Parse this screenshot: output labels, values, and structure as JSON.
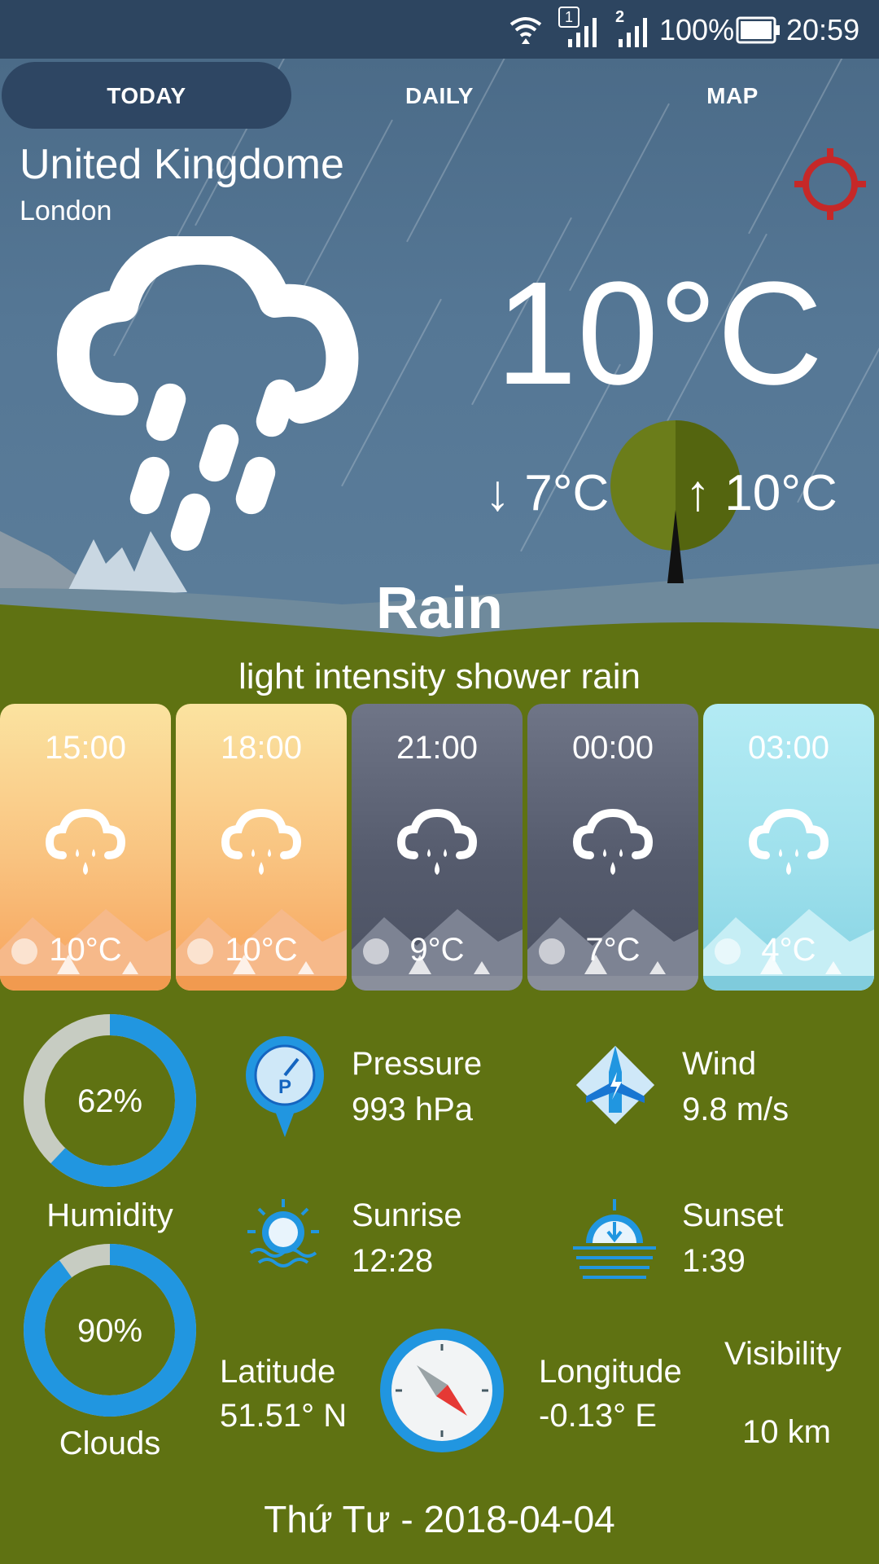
{
  "status_bar": {
    "sim1": "1",
    "sim2": "2",
    "battery": "100%",
    "time": "20:59"
  },
  "tabs": [
    {
      "label": "TODAY"
    },
    {
      "label": "DAILY"
    },
    {
      "label": "MAP"
    }
  ],
  "location": {
    "country": "United Kingdome",
    "city": "London"
  },
  "current": {
    "temp": "10°C",
    "min": "↓ 7°C",
    "max": "↑ 10°C",
    "condition": "Rain",
    "description": "light intensity shower rain"
  },
  "forecast": [
    {
      "time": "15:00",
      "temp": "10°C",
      "theme": "day"
    },
    {
      "time": "18:00",
      "temp": "10°C",
      "theme": "day"
    },
    {
      "time": "21:00",
      "temp": "9°C",
      "theme": "night"
    },
    {
      "time": "00:00",
      "temp": "7°C",
      "theme": "night"
    },
    {
      "time": "03:00",
      "temp": "4°C",
      "theme": "dawn"
    }
  ],
  "humidity": {
    "value": "62%",
    "label": "Humidity",
    "level": 0.62
  },
  "clouds": {
    "value": "90%",
    "label": "Clouds",
    "level": 0.9
  },
  "pressure": {
    "title": "Pressure",
    "value": "993 hPa"
  },
  "wind": {
    "title": "Wind",
    "value": "9.8 m/s"
  },
  "sunrise": {
    "title": "Sunrise",
    "value": "12:28"
  },
  "sunset": {
    "title": "Sunset",
    "value": "1:39"
  },
  "latitude": {
    "title": "Latitude",
    "value": "51.51° N"
  },
  "longitude": {
    "title": "Longitude",
    "value": "-0.13° E"
  },
  "visibility": {
    "title": "Visibility",
    "value": "10 km"
  },
  "date": "Thứ Tư - 2018-04-04",
  "colors": {
    "accent_blue": "#2196e0",
    "locate_red": "#c62828",
    "grass": "#5f7212",
    "sky": "#557795"
  }
}
